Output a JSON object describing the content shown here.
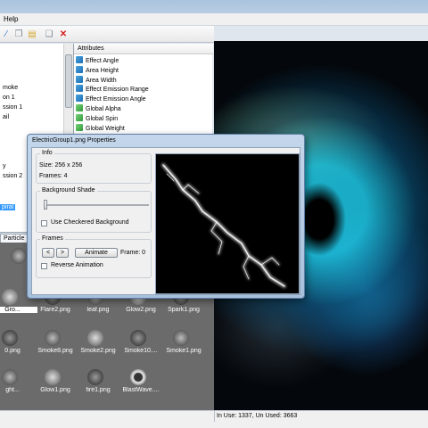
{
  "menu": {
    "help": "Help"
  },
  "tree": {
    "items": [
      "moke",
      "on 1",
      "ssion 1",
      "ail",
      "y",
      "ssion 2",
      "piral"
    ],
    "selected_index": 6
  },
  "attributes": {
    "header": "Attributes",
    "items": [
      {
        "label": "Effect Angle",
        "icon": "blue"
      },
      {
        "label": "Area Height",
        "icon": "blue"
      },
      {
        "label": "Area Width",
        "icon": "blue"
      },
      {
        "label": "Effect Emission Range",
        "icon": "blue"
      },
      {
        "label": "Effect Emission Angle",
        "icon": "blue"
      },
      {
        "label": "Global Alpha",
        "icon": "green"
      },
      {
        "label": "Global Spin",
        "icon": "green"
      },
      {
        "label": "Global Weight",
        "icon": "green"
      }
    ]
  },
  "tabs": {
    "particle": "Particle"
  },
  "library": {
    "row0": [
      "",
      "smo"
    ],
    "row1": [
      "Gro...",
      "Flare2.png",
      "leaf.png",
      "Glow2.png",
      "Spark1.png"
    ],
    "row2": [
      "0.png",
      "Smoke8.png",
      "Smoke2.png",
      "Smoke10....",
      "Smoke1.png"
    ],
    "row3": [
      "ght...",
      "Glow1.png",
      "fire1.png",
      "BlastWave...."
    ]
  },
  "dialog": {
    "title": "ElectricGroup1.png Properties",
    "info_title": "Info",
    "size": "Size: 256 x 256",
    "frames_info": "Frames: 4",
    "bg_title": "Background Shade",
    "checkered": "Use Checkered Background",
    "frames_title": "Frames",
    "prev": "<",
    "next": ">",
    "animate": "Animate",
    "frame_readout": "Frame: 0",
    "reverse": "Reverse Animation"
  },
  "status": {
    "text": "In Use: 1337, Un Used: 3663"
  }
}
